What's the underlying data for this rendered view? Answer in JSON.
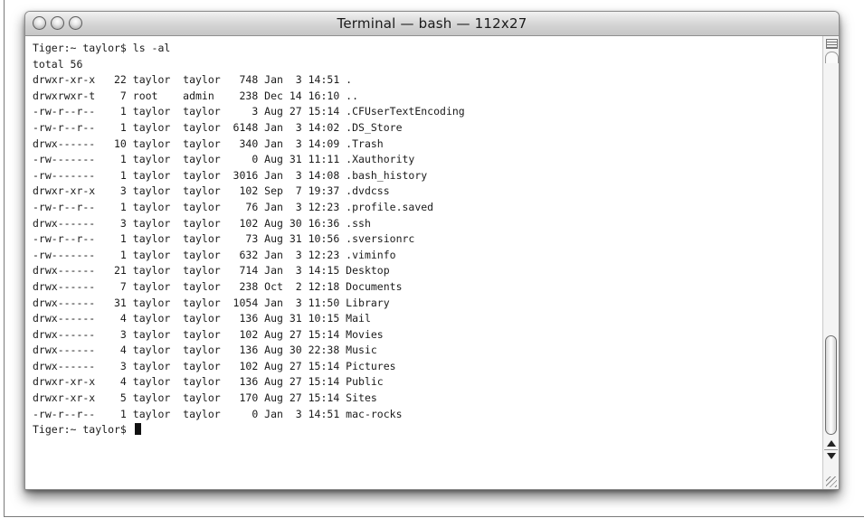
{
  "window": {
    "title": "Terminal — bash — 112x27"
  },
  "terminal": {
    "lines": [
      "Tiger:~ taylor$ ls -al",
      "total 56",
      "drwxr-xr-x   22 taylor  taylor   748 Jan  3 14:51 .",
      "drwxrwxr-t    7 root    admin    238 Dec 14 16:10 ..",
      "-rw-r--r--    1 taylor  taylor     3 Aug 27 15:14 .CFUserTextEncoding",
      "-rw-r--r--    1 taylor  taylor  6148 Jan  3 14:02 .DS_Store",
      "drwx------   10 taylor  taylor   340 Jan  3 14:09 .Trash",
      "-rw-------    1 taylor  taylor     0 Aug 31 11:11 .Xauthority",
      "-rw-------    1 taylor  taylor  3016 Jan  3 14:08 .bash_history",
      "drwxr-xr-x    3 taylor  taylor   102 Sep  7 19:37 .dvdcss",
      "-rw-r--r--    1 taylor  taylor    76 Jan  3 12:23 .profile.saved",
      "drwx------    3 taylor  taylor   102 Aug 30 16:36 .ssh",
      "-rw-r--r--    1 taylor  taylor    73 Aug 31 10:56 .sversionrc",
      "-rw-------    1 taylor  taylor   632 Jan  3 12:23 .viminfo",
      "drwx------   21 taylor  taylor   714 Jan  3 14:15 Desktop",
      "drwx------    7 taylor  taylor   238 Oct  2 12:18 Documents",
      "drwx------   31 taylor  taylor  1054 Jan  3 11:50 Library",
      "drwx------    4 taylor  taylor   136 Aug 31 10:15 Mail",
      "drwx------    3 taylor  taylor   102 Aug 27 15:14 Movies",
      "drwx------    4 taylor  taylor   136 Aug 30 22:38 Music",
      "drwx------    3 taylor  taylor   102 Aug 27 15:14 Pictures",
      "drwxr-xr-x    4 taylor  taylor   136 Aug 27 15:14 Public",
      "drwxr-xr-x    5 taylor  taylor   170 Aug 27 15:14 Sites",
      "-rw-r--r--    1 taylor  taylor     0 Jan  3 14:51 mac-rocks"
    ],
    "prompt": "Tiger:~ taylor$ "
  },
  "icons": {
    "close": "close-button",
    "minimize": "minimize-button",
    "zoom": "zoom-button",
    "split": "split-pane-icon",
    "scroll_up": "scroll-up-arrow-icon",
    "scroll_down": "scroll-down-arrow-icon",
    "resize": "resize-grip-icon"
  }
}
